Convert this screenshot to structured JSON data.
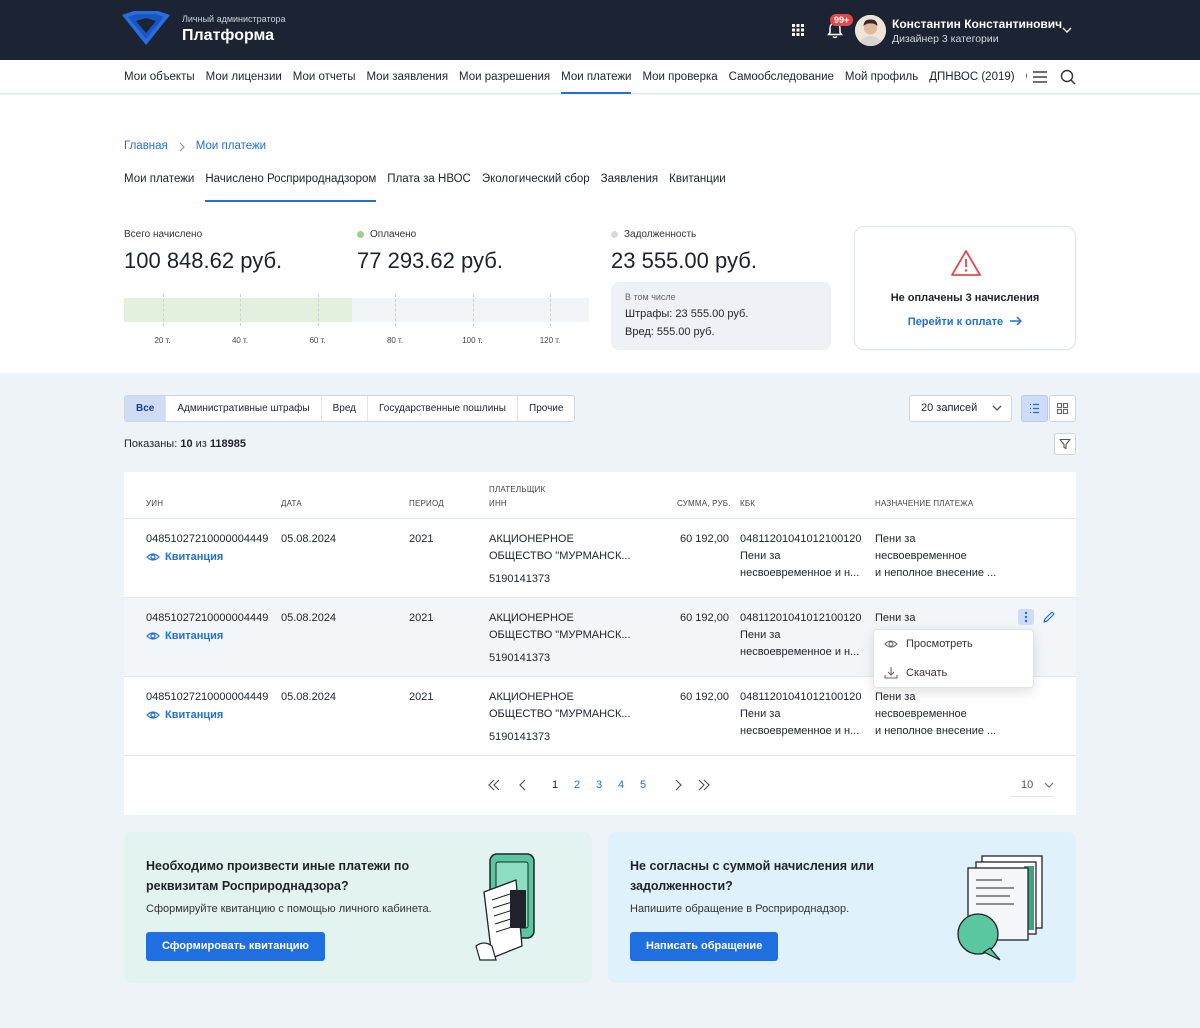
{
  "header": {
    "brand_sub": "Личный администратора",
    "brand_title": "Платформа",
    "notifications_badge": "99+",
    "user_name": "Константин Константинович",
    "user_role": "Дизайнер 3 категории"
  },
  "nav": {
    "items": [
      {
        "label": "Мои объекты"
      },
      {
        "label": "Мои лицензии"
      },
      {
        "label": "Мои отчеты"
      },
      {
        "label": "Мои заявления"
      },
      {
        "label": "Мои разрешения"
      },
      {
        "label": "Мои платежи"
      },
      {
        "label": "Мои проверка"
      },
      {
        "label": "Самообследование"
      },
      {
        "label": "Мой профиль"
      },
      {
        "label": "ДПНВОС (2019)"
      },
      {
        "label": "Справочник"
      }
    ],
    "active": "Мои платежи"
  },
  "breadcrumb": {
    "home": "Главная",
    "current": "Мои платежи"
  },
  "subtabs": [
    "Мои платежи",
    "Начислено Росприроднадзором",
    "Плата за НВОС",
    "Экологический сбор",
    "Заявления",
    "Квитанции"
  ],
  "stats": {
    "total_label": "Всего начислено",
    "total_value": "100 848.62 руб.",
    "paid_label": "Оплачено",
    "paid_value": "77 293.62 руб.",
    "debt_label": "Задолженность",
    "debt_value": "23 555.00 руб.",
    "paid_fraction": 0.49,
    "ticks": [
      "20 т.",
      "40 т.",
      "60 т.",
      "80 т.",
      "100 т.",
      "120 т."
    ],
    "debt_breakdown_head": "В том числе",
    "debt_fines": "Штрафы: 23 555.00 руб.",
    "debt_harm": "Вред: 555.00 руб.",
    "colors": {
      "paid": "#9fd08a",
      "debt": "#d6dbe1"
    }
  },
  "alert": {
    "title": "Не оплачены 3 начисления",
    "link": "Перейти к оплате"
  },
  "filters": [
    "Все",
    "Административные штрафы",
    "Вред",
    "Государственные пошлины",
    "Прочие"
  ],
  "records_select": "20 записей",
  "shown": {
    "prefix": "Показаны: ",
    "count": "10",
    "middle": " из ",
    "total": "118985"
  },
  "table": {
    "headers": {
      "uin": "УИН",
      "date": "Дата",
      "period": "Период",
      "payer_1": "Плательщик",
      "payer_2": "ИНН",
      "sum": "Сумма, руб.",
      "kbk": "КБК",
      "purpose": "Назначение платежа"
    },
    "receipt_label": "Квитанция",
    "rows": [
      {
        "uin": "04851027210000004449",
        "date": "05.08.2024",
        "period": "2021",
        "payer_1": "АКЦИОНЕРНОЕ",
        "payer_2": "ОБЩЕСТВО \"МУРМАНСК...",
        "inn": "5190141373",
        "sum": "60 192,00",
        "kbk_1": "04811201041012100120",
        "kbk_2": "Пени за",
        "kbk_3": "несвоевременное и н...",
        "purpose_1": "Пени за",
        "purpose_2": "несвоевременное",
        "purpose_3": "и неполное внесение ..."
      },
      {
        "uin": "04851027210000004449",
        "date": "05.08.2024",
        "period": "2021",
        "payer_1": "АКЦИОНЕРНОЕ",
        "payer_2": "ОБЩЕСТВО \"МУРМАНСК...",
        "inn": "5190141373",
        "sum": "60 192,00",
        "kbk_1": "04811201041012100120",
        "kbk_2": "Пени за",
        "kbk_3": "несвоевременное и н...",
        "purpose_1": "Пени за",
        "purpose_2": "",
        "purpose_3": ""
      },
      {
        "uin": "04851027210000004449",
        "date": "05.08.2024",
        "period": "2021",
        "payer_1": "АКЦИОНЕРНОЕ",
        "payer_2": "ОБЩЕСТВО \"МУРМАНСК...",
        "inn": "5190141373",
        "sum": "60 192,00",
        "kbk_1": "04811201041012100120",
        "kbk_2": "Пени за",
        "kbk_3": "несвоевременное и н...",
        "purpose_1": "Пени за",
        "purpose_2": "несвоевременное",
        "purpose_3": "и неполное внесение ..."
      }
    ]
  },
  "row_menu": {
    "view": "Просмотреть",
    "download": "Скачать"
  },
  "pagination": {
    "pages": [
      "1",
      "2",
      "3",
      "4",
      "5"
    ],
    "current": "1",
    "per_page": "10"
  },
  "promo_left": {
    "title": "Необходимо произвести иные платежи по реквизитам Росприроднадзора?",
    "text": "Сформируйте квитанцию с помощью личного кабинета.",
    "button": "Сформировать квитанцию"
  },
  "promo_right": {
    "title": "Не согласны с суммой начисления или задолженности?",
    "text": "Напишите обращение в Росприроднадзор.",
    "button": "Написать обращение"
  }
}
